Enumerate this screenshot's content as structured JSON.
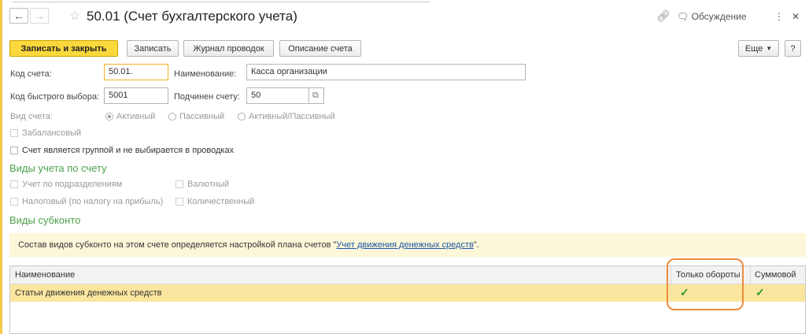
{
  "header": {
    "title": "50.01 (Счет бухгалтерского учета)",
    "discussion_label": "Обсуждение",
    "more_icon": "kebab-icon",
    "close_icon": "close-icon"
  },
  "toolbar": {
    "save_close_label": "Записать и закрыть",
    "save_label": "Записать",
    "journal_label": "Журнал проводок",
    "description_label": "Описание счета",
    "more_label": "Еще",
    "help_label": "?"
  },
  "form": {
    "account_code_label": "Код счета:",
    "account_code_value": "50.01.",
    "name_label": "Наименование:",
    "name_value": "Касса организации",
    "quick_code_label": "Код быстрого выбора:",
    "quick_code_value": "5001",
    "parent_label": "Подчинен счету:",
    "parent_value": "50",
    "account_type_label": "Вид счета:",
    "radio_active": "Активный",
    "radio_passive": "Пассивный",
    "radio_active_passive": "Активный/Пассивный",
    "offbalance_label": "Забалансовый",
    "group_label": "Счет является группой и не выбирается в проводках"
  },
  "accounting_types": {
    "title": "Виды учета по счету",
    "by_division": "Учет по подразделениям",
    "currency": "Валютный",
    "tax": "Налоговый (по налогу на прибыль)",
    "quantity": "Количественный"
  },
  "subconto": {
    "title": "Виды субконто",
    "info_text": "Состав видов субконто на этом счете определяется настройкой плана счетов \"",
    "info_link": "Учет движения денежных средств",
    "info_suffix": "\".",
    "columns": [
      "Наименование",
      "Только обороты",
      "Суммовой"
    ],
    "rows": [
      {
        "name": "Статьи движения денежных средств",
        "turnover_only": "✓",
        "sum": "✓"
      }
    ]
  },
  "colors": {
    "primary_button": "#fbd83c",
    "section_title": "#4ba04b",
    "highlight_ring": "#ee8c3a",
    "selected_row": "#fbe69f"
  }
}
